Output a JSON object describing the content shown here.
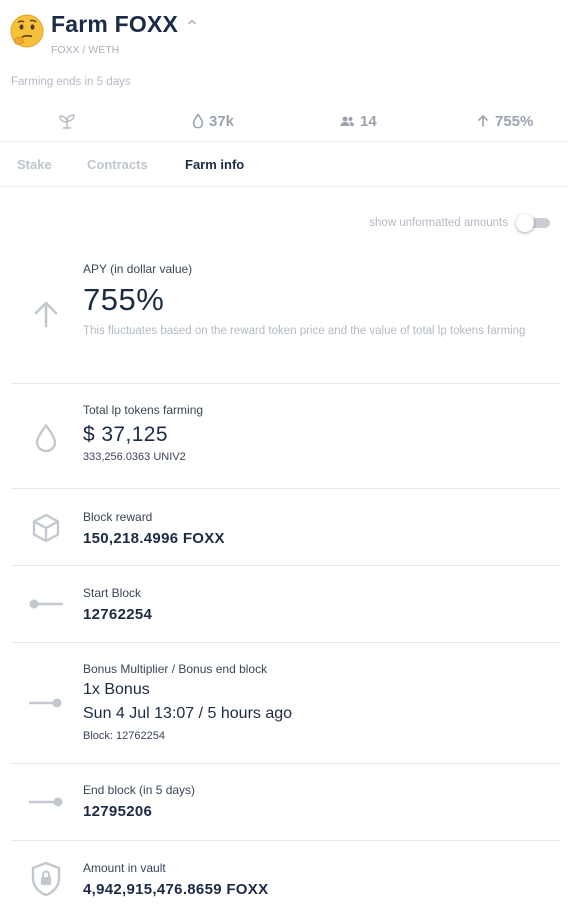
{
  "header": {
    "title": "Farm FOXX",
    "pair": "FOXX / WETH",
    "ends": "Farming ends in 5 days"
  },
  "stats": [
    {
      "icon": "sprout-icon",
      "value": ""
    },
    {
      "icon": "drop-icon",
      "value": "37k"
    },
    {
      "icon": "users-icon",
      "value": "14"
    },
    {
      "icon": "arrow-up-icon",
      "value": "755%"
    }
  ],
  "tabs": [
    {
      "label": "Stake",
      "active": false
    },
    {
      "label": "Contracts",
      "active": false
    },
    {
      "label": "Farm info",
      "active": true
    }
  ],
  "toggle": {
    "label": "show unformatted amounts",
    "on": false
  },
  "info": {
    "apy": {
      "label": "APY (in dollar value)",
      "value": "755%",
      "note": "This fluctuates based on the reward token price and the value of total lp tokens farming"
    },
    "total": {
      "label": "Total lp tokens farming",
      "value": "$ 37,125",
      "sub": "333,256.0363 UNIV2"
    },
    "reward": {
      "label": "Block reward",
      "value": "150,218.4996 FOXX"
    },
    "start": {
      "label": "Start Block",
      "value": "12762254"
    },
    "bonus": {
      "label": "Bonus Multiplier / Bonus end block",
      "multiplier": "1x Bonus",
      "end": "Sun 4 Jul 13:07 / 5 hours ago",
      "block": "Block: 12762254"
    },
    "end": {
      "label": "End block (in 5 days)",
      "value": "12795206"
    },
    "vault": {
      "label": "Amount in vault",
      "value": "4,942,915,476.8659 FOXX"
    }
  },
  "colors": {
    "text": "#1c2b45",
    "muted": "#b4bac4",
    "icon": "#c3c8cf"
  }
}
